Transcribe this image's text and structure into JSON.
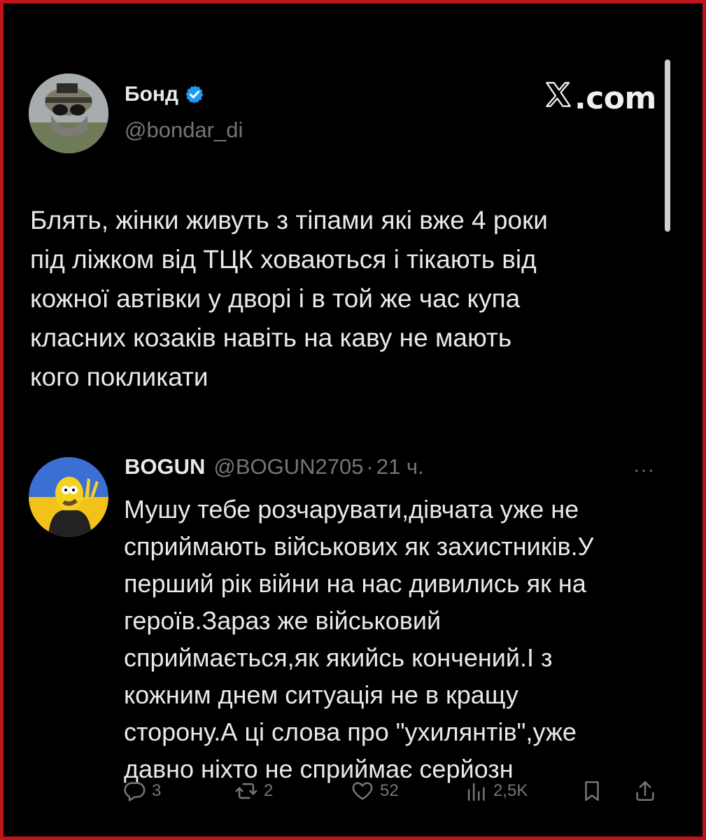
{
  "tweet": {
    "author_name": "Бонд",
    "author_handle": "@bondar_di",
    "brand": "X.com",
    "brand_suffix": ".com",
    "text": "Блять, жінки живуть з тіпами які вже 4 роки\nпід ліжком від ТЦК ховаються і тікають від\nкожної автівки у дворі і в той же час купа\nкласних козаків навіть на каву не мають\nкого покликати"
  },
  "reply": {
    "author_name": "BOGUN",
    "author_handle": "@BOGUN2705",
    "separator": "·",
    "time": "21 ч.",
    "more": "···",
    "text": "Мушу тебе розчарувати,дівчата уже не\nсприймають військових як захистників.У\nперший рік війни на нас дивились як на\nгероїв.Зараз же військовий\nсприймається,як якийсь кончений.І з\nкожним днем ситуація не в кращу\nсторону.А ці слова про \"ухилянтів\",уже\nдавно ніхто не сприймає серйозн",
    "actions": {
      "replies": "3",
      "reposts": "2",
      "likes": "52",
      "views": "2,5K"
    }
  },
  "icons": {
    "verified": "verified-badge-icon",
    "reply": "reply-icon",
    "repost": "repost-icon",
    "like": "heart-icon",
    "views": "views-icon",
    "bookmark": "bookmark-icon",
    "share": "share-icon"
  },
  "colors": {
    "background": "#000000",
    "frame": "#c0141b",
    "text": "#e7e9ea",
    "muted": "#71767b",
    "verified": "#1d9bf0"
  }
}
